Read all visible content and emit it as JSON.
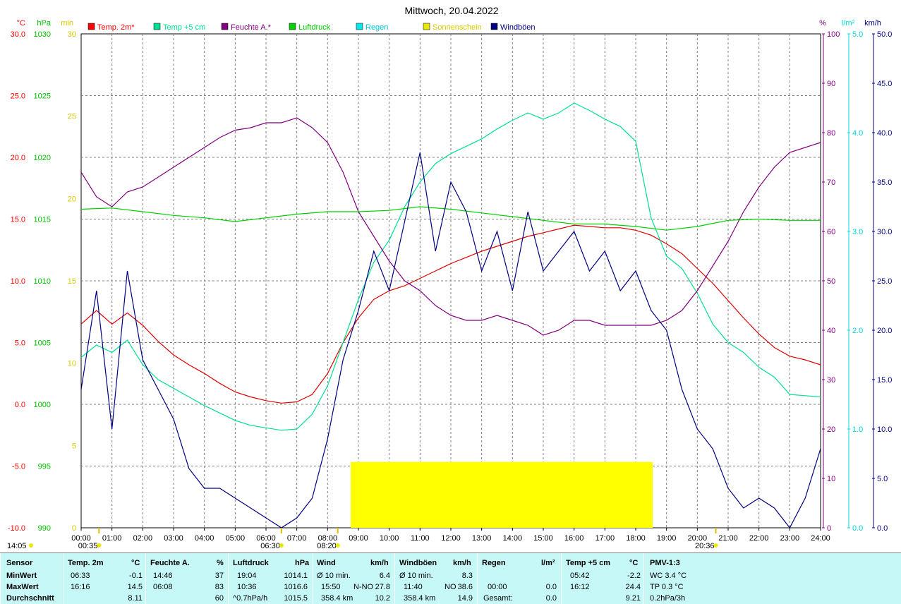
{
  "chart_data": {
    "type": "line",
    "title": "Mittwoch, 20.04.2022",
    "axes": {
      "temp": {
        "unit": "°C",
        "ticks": [
          "30.0",
          "25.0",
          "20.0",
          "15.0",
          "10.0",
          "5.0",
          "0.0",
          "-5.0",
          "-10.0"
        ],
        "min": -10,
        "max": 30,
        "color": "#ff0000"
      },
      "pressure": {
        "unit": "hPa",
        "ticks": [
          "1030",
          "1025",
          "1020",
          "1015",
          "1010",
          "1005",
          "1000",
          "995",
          "990"
        ],
        "min": 990,
        "max": 1030,
        "color": "#00c000"
      },
      "sun": {
        "unit": "min",
        "ticks": [
          "30",
          "25",
          "20",
          "15",
          "10",
          "5",
          "0"
        ],
        "min": 0,
        "max": 30,
        "color": "#e8e800"
      },
      "humidity": {
        "unit": "%",
        "ticks": [
          "100",
          "90",
          "80",
          "70",
          "60",
          "50",
          "40",
          "30",
          "20",
          "10",
          "0"
        ],
        "min": 0,
        "max": 100,
        "color": "#800080"
      },
      "rain": {
        "unit": "l/m²",
        "ticks": [
          "5.0",
          "4.0",
          "3.0",
          "2.0",
          "1.0",
          "0.0"
        ],
        "min": 0,
        "max": 5,
        "color": "#00e0e0"
      },
      "wind": {
        "unit": "km/h",
        "ticks": [
          "50.0",
          "45.0",
          "40.0",
          "35.0",
          "30.0",
          "25.0",
          "20.0",
          "15.0",
          "10.0",
          "5.0",
          "0.0"
        ],
        "min": 0,
        "max": 50,
        "color": "#000080"
      }
    },
    "x_ticks": [
      "00:00",
      "01:00",
      "02:00",
      "03:00",
      "04:00",
      "05:00",
      "06:00",
      "07:00",
      "08:00",
      "09:00",
      "10:00",
      "11:00",
      "12:00",
      "13:00",
      "14:00",
      "15:00",
      "16:00",
      "17:00",
      "18:00",
      "19:00",
      "20:00",
      "21:00",
      "22:00",
      "23:00",
      "24:00"
    ],
    "legend": [
      {
        "name": "Temp. 2m*",
        "color": "#ff0000"
      },
      {
        "name": "Temp +5 cm",
        "color": "#00e090"
      },
      {
        "name": "Feuchte A.*",
        "color": "#800080"
      },
      {
        "name": "Luftdruck",
        "color": "#00d000"
      },
      {
        "name": "Regen",
        "color": "#00e8e8"
      },
      {
        "name": "Sonnenschein",
        "color": "#e8e800"
      },
      {
        "name": "Windböen",
        "color": "#000080"
      }
    ],
    "markers_below": [
      {
        "label": "14:05"
      },
      {
        "label": "00:35",
        "hour": 0.58
      },
      {
        "label": "06:30",
        "hour": 6.5
      },
      {
        "label": "08:20",
        "hour": 8.33
      },
      {
        "label": "20:36",
        "hour": 20.6
      }
    ],
    "series": [
      {
        "name": "Temp. 2m*",
        "axis": "temp",
        "x": [
          0,
          0.5,
          1,
          1.5,
          2,
          2.5,
          3,
          3.5,
          4,
          4.5,
          5,
          5.5,
          6,
          6.5,
          7,
          7.5,
          8,
          8.5,
          9,
          9.5,
          10,
          10.5,
          11,
          11.5,
          12,
          12.5,
          13,
          13.5,
          14,
          14.5,
          15,
          15.5,
          16,
          16.5,
          17,
          17.5,
          18,
          18.5,
          19,
          19.5,
          20,
          20.5,
          21,
          21.5,
          22,
          22.5,
          23,
          23.5,
          24
        ],
        "y": [
          6.5,
          7.6,
          6.5,
          7.4,
          6.4,
          5.1,
          4.0,
          3.2,
          2.5,
          1.7,
          1.0,
          0.6,
          0.3,
          0.1,
          0.2,
          0.8,
          2.5,
          5.0,
          7.0,
          8.5,
          9.2,
          9.6,
          10.2,
          10.8,
          11.4,
          11.9,
          12.4,
          12.8,
          13.2,
          13.6,
          13.9,
          14.2,
          14.5,
          14.4,
          14.3,
          14.3,
          14.1,
          13.7,
          13.0,
          12.2,
          11.0,
          9.8,
          8.4,
          7.0,
          5.7,
          4.6,
          3.9,
          3.6,
          3.2
        ]
      },
      {
        "name": "Temp +5 cm",
        "axis": "temp",
        "x": [
          0,
          0.5,
          1,
          1.5,
          2,
          2.5,
          3,
          3.5,
          4,
          4.5,
          5,
          5.5,
          6,
          6.5,
          7,
          7.5,
          8,
          8.5,
          9,
          9.5,
          10,
          10.5,
          11,
          11.5,
          12,
          12.5,
          13,
          13.5,
          14,
          14.5,
          15,
          15.5,
          16,
          16.5,
          17,
          17.5,
          18,
          18.5,
          19,
          19.5,
          20,
          20.5,
          21,
          21.5,
          22,
          22.5,
          23,
          23.5,
          24
        ],
        "y": [
          3.8,
          4.8,
          4.2,
          5.2,
          3.2,
          2.0,
          1.3,
          0.6,
          -0.1,
          -0.7,
          -1.3,
          -1.7,
          -1.9,
          -2.1,
          -2.0,
          -0.8,
          1.5,
          5.0,
          8.5,
          11.5,
          13.3,
          16.0,
          18.0,
          19.5,
          20.3,
          20.9,
          21.5,
          22.3,
          23.0,
          23.6,
          23.1,
          23.6,
          24.4,
          23.8,
          23.1,
          22.5,
          21.3,
          15.1,
          12.0,
          11.0,
          9.0,
          6.5,
          5.0,
          4.2,
          3.0,
          2.2,
          0.8,
          0.7,
          0.6
        ]
      },
      {
        "name": "Feuchte A.*",
        "axis": "humidity",
        "x": [
          0,
          0.5,
          1,
          1.5,
          2,
          2.5,
          3,
          3.5,
          4,
          4.5,
          5,
          5.5,
          6,
          6.5,
          7,
          7.5,
          8,
          8.5,
          9,
          9.5,
          10,
          10.5,
          11,
          11.5,
          12,
          12.5,
          13,
          13.5,
          14,
          14.5,
          15,
          15.5,
          16,
          16.5,
          17,
          17.5,
          18,
          18.5,
          19,
          19.5,
          20,
          20.5,
          21,
          21.5,
          22,
          22.5,
          23,
          23.5,
          24
        ],
        "y": [
          72,
          67,
          65,
          68,
          69,
          71,
          73,
          75,
          77,
          79,
          80.5,
          81,
          82,
          82,
          83,
          81,
          78,
          72,
          64,
          59,
          54,
          50,
          48,
          45,
          43,
          42,
          42,
          43,
          42,
          41,
          39,
          40,
          42,
          42,
          41,
          41,
          41,
          41,
          42,
          44,
          48,
          53,
          58,
          64,
          69,
          73,
          76,
          77,
          78
        ]
      },
      {
        "name": "Luftdruck",
        "axis": "pressure",
        "x": [
          0,
          1,
          2,
          3,
          4,
          5,
          6,
          7,
          8,
          9,
          10,
          11,
          12,
          13,
          14,
          15,
          16,
          17,
          18,
          19,
          20,
          21,
          22,
          23,
          24
        ],
        "y": [
          1015.8,
          1015.9,
          1015.6,
          1015.3,
          1015.1,
          1014.8,
          1015.1,
          1015.4,
          1015.6,
          1015.6,
          1015.7,
          1016.0,
          1015.8,
          1015.5,
          1015.2,
          1014.9,
          1014.6,
          1014.6,
          1014.4,
          1014.1,
          1014.4,
          1014.9,
          1015.0,
          1014.9,
          1014.9
        ]
      },
      {
        "name": "Windböen",
        "axis": "wind",
        "x": [
          0,
          0.5,
          1,
          1.5,
          2,
          2.5,
          3,
          3.5,
          4,
          4.5,
          5,
          5.5,
          6,
          6.5,
          7,
          7.5,
          8,
          8.5,
          9,
          9.5,
          10,
          10.5,
          11,
          11.5,
          12,
          12.5,
          13,
          13.5,
          14,
          14.5,
          15,
          15.5,
          16,
          16.5,
          17,
          17.5,
          18,
          18.5,
          19,
          19.5,
          20,
          20.5,
          21,
          21.5,
          22,
          22.5,
          23,
          23.5,
          24
        ],
        "y": [
          14,
          24,
          10,
          26,
          17,
          14,
          11,
          6,
          4,
          4,
          3,
          2,
          1,
          0,
          1,
          3,
          9,
          17,
          22,
          28,
          24,
          31,
          38,
          28,
          35,
          32,
          26,
          30,
          24,
          32,
          26,
          28,
          30,
          26,
          28,
          24,
          26,
          22,
          20,
          14,
          10,
          8,
          4,
          2,
          3,
          2,
          0,
          3,
          8
        ]
      }
    ],
    "sunshine": {
      "start_hour": 8.75,
      "end_hour": 18.55,
      "level_min": 4
    }
  },
  "summary": {
    "sensor": {
      "title": "Sensor",
      "rows": [
        "MinWert",
        "MaxWert",
        "Durchschnitt"
      ]
    },
    "temp2m": {
      "title": "Temp. 2m",
      "unit": "°C",
      "times": [
        "06:33",
        "16:16",
        ""
      ],
      "values": [
        "-0.1",
        "14.5",
        "8.11"
      ]
    },
    "feuchte": {
      "title": "Feuchte A.",
      "unit": "%",
      "times": [
        "14:46",
        "06:08",
        ""
      ],
      "values": [
        "37",
        "83",
        "60"
      ]
    },
    "luftdruck": {
      "title": "Luftdruck",
      "unit": "hPa",
      "times": [
        "19:04",
        "10:36",
        "^0.7hPa/h"
      ],
      "values": [
        "1014.1",
        "1016.6",
        "1015.5"
      ]
    },
    "wind": {
      "title": "Wind",
      "unit": "km/h",
      "labels": [
        "Ø 10 min.",
        "15:50",
        "358.4 km"
      ],
      "mid": [
        "",
        "N-NO",
        ""
      ],
      "values": [
        "6.4",
        "27.8",
        "10.2"
      ]
    },
    "windboeen": {
      "title": "Windböen",
      "unit": "km/h",
      "labels": [
        "Ø 10 min.",
        "11:40",
        "358.4 km"
      ],
      "mid": [
        "",
        "NO",
        ""
      ],
      "values": [
        "8.3",
        "38.6",
        "14.9"
      ]
    },
    "regen": {
      "title": "Regen",
      "unit": "l/m²",
      "labels": [
        "",
        "00:00",
        "Gesamt:"
      ],
      "values": [
        "",
        "0.0",
        "0.0"
      ]
    },
    "temp5cm": {
      "title": "Temp +5 cm",
      "unit": "°C",
      "times": [
        "05:42",
        "16:12",
        ""
      ],
      "values": [
        "-2.2",
        "24.4",
        "9.21"
      ]
    },
    "pmv": {
      "title": "PMV-1:3",
      "rows": [
        "WC 3.4 °C",
        "TP 0.3 °C",
        "0.2hPa/3h"
      ]
    }
  }
}
